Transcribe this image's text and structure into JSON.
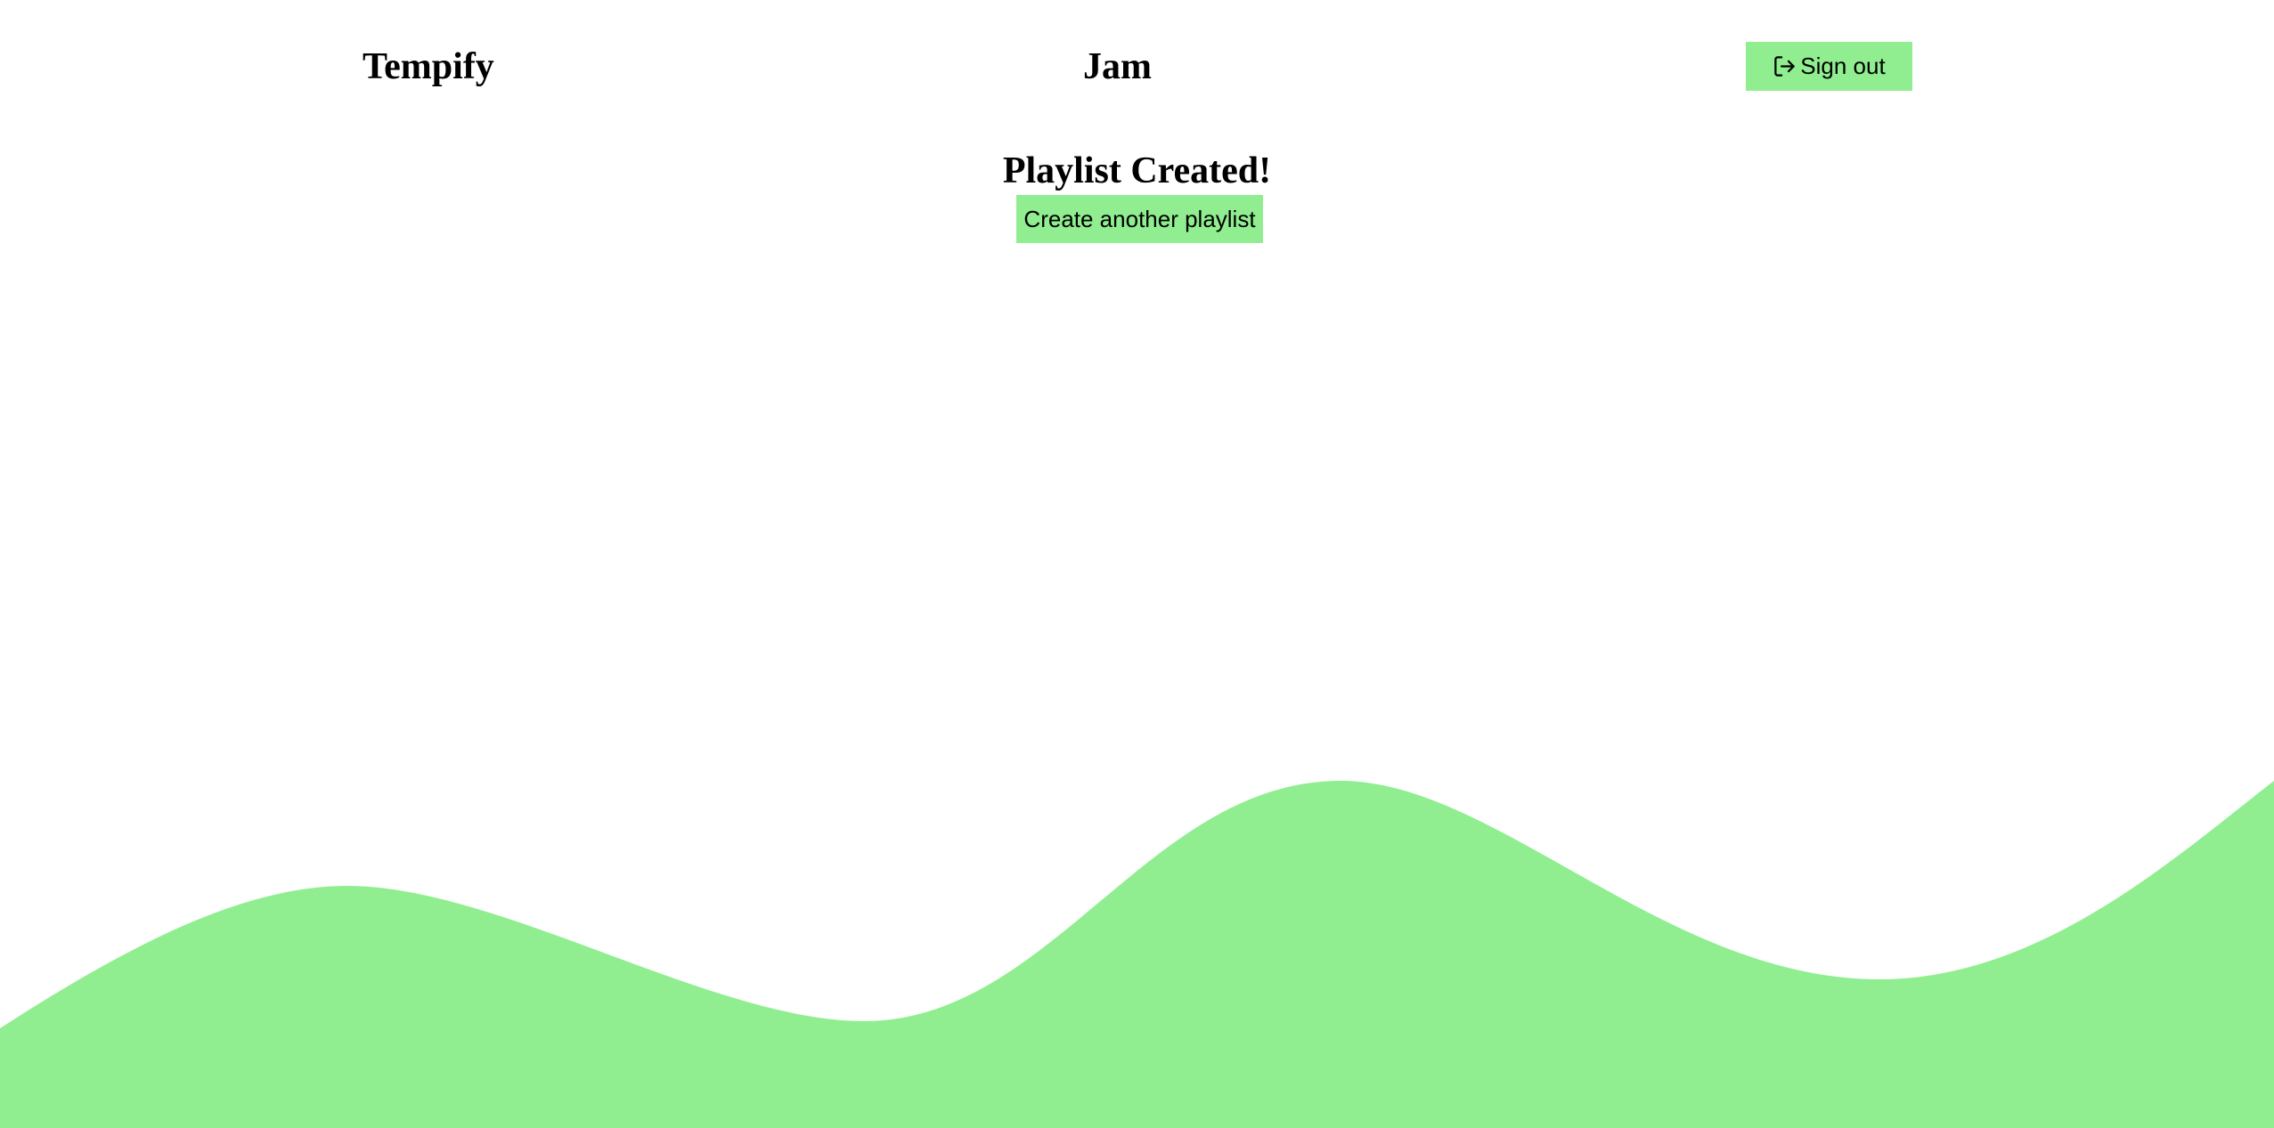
{
  "header": {
    "brand": "Tempify",
    "user_name": "Jam",
    "signout_label": "Sign out",
    "signout_icon": "sign-out-icon"
  },
  "main": {
    "title": "Playlist Created!",
    "create_another_label": "Create another playlist"
  },
  "colors": {
    "accent": "#90ee90",
    "background": "#ffffff",
    "text": "#000000"
  }
}
